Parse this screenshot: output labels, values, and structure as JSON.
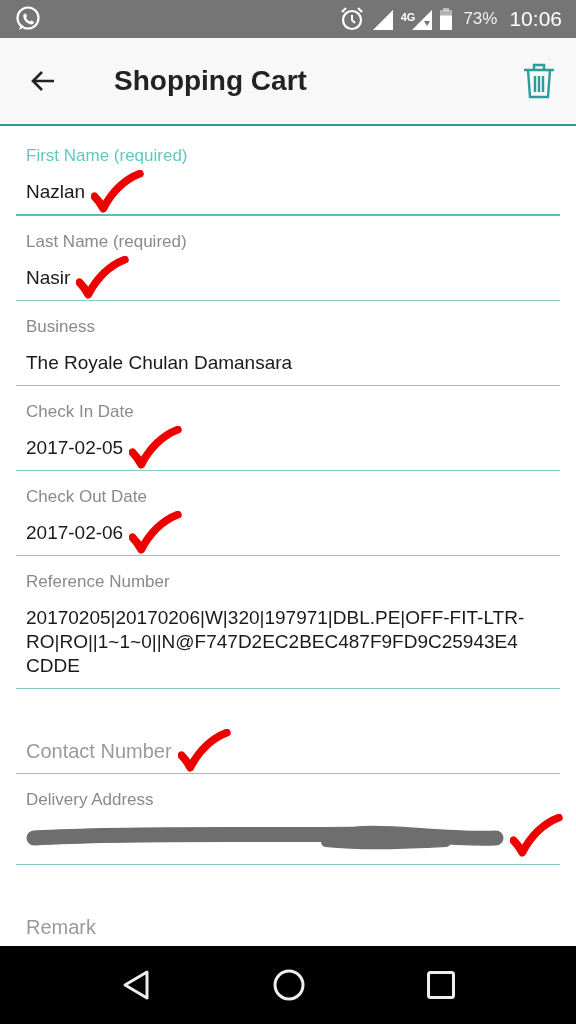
{
  "status_bar": {
    "battery": "73%",
    "time": "10:06",
    "network": "4G"
  },
  "app_bar": {
    "title": "Shopping Cart"
  },
  "fields": [
    {
      "kind": "text",
      "label": "First Name (required)",
      "value": "Nazlan",
      "focused": true,
      "ticked": true
    },
    {
      "kind": "text",
      "label": "Last Name (required)",
      "value": "Nasir",
      "focused": false,
      "ticked": true
    },
    {
      "kind": "text",
      "label": "Business",
      "value": "The Royale Chulan Damansara",
      "focused": false,
      "ticked": false
    },
    {
      "kind": "text",
      "label": "Check In Date",
      "value": "2017-02-05",
      "focused": false,
      "ticked": true
    },
    {
      "kind": "text",
      "label": "Check Out Date",
      "value": "2017-02-06",
      "focused": false,
      "ticked": true
    },
    {
      "kind": "text",
      "label": "Reference Number",
      "value": "20170205|20170206|W|320|197971|DBL.PE|OFF-FIT-LTR-RO|RO||1~1~0||N@F747D2EC2BEC487F9FD9C25943E4CDDE",
      "focused": false,
      "ticked": false
    },
    {
      "kind": "hint",
      "placeholder": "Contact Number",
      "focused": false,
      "ticked": true
    },
    {
      "kind": "redacted",
      "label": "Delivery Address",
      "focused": false,
      "ticked": true
    },
    {
      "kind": "hint",
      "placeholder": "Remark",
      "focused": false,
      "ticked": false
    }
  ]
}
